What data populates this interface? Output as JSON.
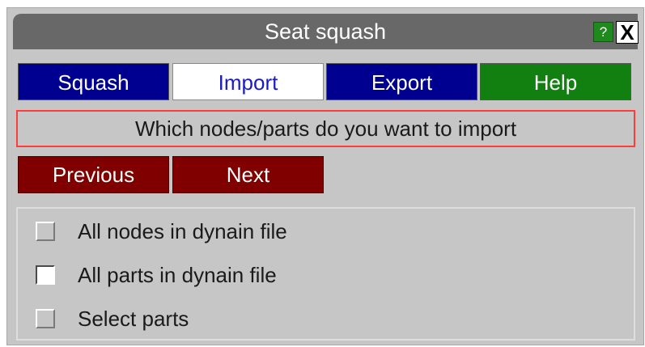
{
  "window": {
    "title": "Seat squash",
    "help_icon": "?",
    "close_icon": "X"
  },
  "tabs": [
    {
      "label": "Squash",
      "active": false
    },
    {
      "label": "Import",
      "active": true
    },
    {
      "label": "Export",
      "active": false
    },
    {
      "label": "Help",
      "active": false
    }
  ],
  "prompt": "Which nodes/parts do you want to import",
  "navigation": {
    "previous_label": "Previous",
    "next_label": "Next"
  },
  "options": [
    {
      "label": "All nodes in dynain file",
      "checked": false
    },
    {
      "label": "All parts in dynain file",
      "checked": true
    },
    {
      "label": "Select parts",
      "checked": false
    }
  ],
  "colors": {
    "title_bar": "#686868",
    "tab_blue": "#000090",
    "tab_green": "#118011",
    "button_red": "#800000",
    "prompt_border": "#ff3c3c",
    "panel_bg": "#c6c6c6"
  }
}
